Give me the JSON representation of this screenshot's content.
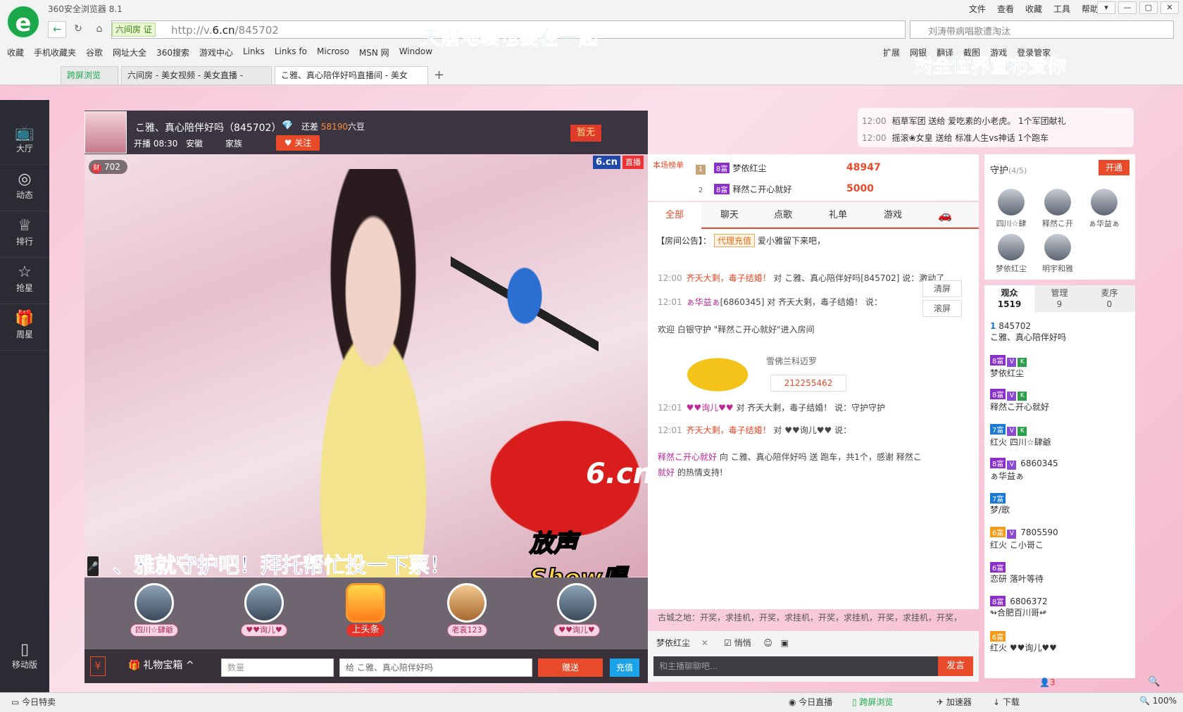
{
  "browser": {
    "title": "360安全浏览器 8.1",
    "menu": [
      "文件",
      "查看",
      "收藏",
      "工具",
      "帮助"
    ],
    "url_prefix": "http://v.",
    "url_host": "6.cn",
    "url_path": "/845702",
    "site_badge": "六间房 证",
    "search_placeholder": "刘涛带病唱歌遭淘汰",
    "overlay_text_1": "天崩地裂也要在一起",
    "overlay_text_2": "对全世界宣布爱你",
    "bookmarks": [
      "收藏",
      "手机收藏夹",
      "谷歌",
      "网址大全",
      "360搜索",
      "游戏中心",
      "Links",
      "Links fo",
      "Microso",
      "MSN 网",
      "Window"
    ],
    "extensions": [
      "扩展",
      "网银",
      "翻译",
      "截图",
      "游戏",
      "登录管家"
    ],
    "tabs": [
      {
        "label": "跨屏浏览"
      },
      {
        "label": "六间房 - 美女视频 - 美女直播 -"
      },
      {
        "label": "こ雅、真心陪伴好吗直播间 - 美女"
      }
    ]
  },
  "nav": {
    "items": [
      "大厅",
      "动态",
      "排行",
      "抢星",
      "周星"
    ],
    "mobile": "移动版"
  },
  "room": {
    "title": "こ雅、真心陪伴好吗（845702）",
    "remain_prefix": "还差",
    "remain_amount": "58190",
    "remain_suffix": "六豆",
    "start": "开播 08:30",
    "location": "安徽",
    "family": "家族",
    "follow": "关注",
    "flag": "暂无",
    "wealth": "702",
    "live_logo": "6.cn",
    "live_tag": "直播",
    "scroll_text": "、雅就守护吧！拜托帮忙投一下票！",
    "show_tag": "放声Show唱",
    "car_logo": "6.cn"
  },
  "stage_guards": [
    {
      "name": "四川☆肆爺"
    },
    {
      "name": "♥♥询儿♥"
    },
    {
      "name": "上头条"
    },
    {
      "name": "老袁123"
    },
    {
      "name": "♥♥询儿♥"
    }
  ],
  "gift": {
    "box": "礼物宝箱",
    "qty_placeholder": "数量",
    "to": "给 こ雅、真心陪伴好吗",
    "send": "赠送",
    "recharge": "充值"
  },
  "notices": [
    {
      "time": "12:00",
      "text": "稻草军团 送给 爱吃素的小老虎。 1个军团献礼"
    },
    {
      "time": "12:00",
      "text": "摇滚❀女皇 送给 标准人生vs神话 1个跑车"
    }
  ],
  "ranking": {
    "label": "本场榜单",
    "rows": [
      {
        "rank": "1",
        "badge": "8富",
        "name": "梦依红尘",
        "score": "48947"
      },
      {
        "rank": "2",
        "badge": "8富",
        "name": "释然こ开心就好",
        "score": "5000"
      }
    ]
  },
  "chat_tabs": [
    "全部",
    "聊天",
    "点歌",
    "礼单",
    "游戏"
  ],
  "chat": {
    "announce_label": "【房间公告】：",
    "announce_tag": "代理充值",
    "announce_text": "爱小雅留下来吧，",
    "lines": [
      {
        "time": "12:00",
        "user": "齐天大剩，毒子结婚！",
        "text": " 对 こ雅、真心陪伴好吗[845702] 说：激动了"
      },
      {
        "time": "12:01",
        "user": "ぁ华益ぁ",
        "text": "[6860345] 对 齐天大剩，毒子结婚！ 说："
      },
      {
        "time": "",
        "user": "欢迎",
        "text": " 白银守护 \"释然こ开心就好\"进入房间"
      },
      {
        "time": "12:01",
        "user": "♥♥询儿♥♥",
        "text": " 对 齐天大剩，毒子结婚！ 说：守护守护"
      },
      {
        "time": "12:01",
        "user": "齐天大剩，毒子结婚！",
        "text": " 对 ♥♥询儿♥♥ 说："
      },
      {
        "time": "",
        "user": "释然こ开心就好",
        "text": " 向 こ雅、真心陪伴好吗 送 跑车，共1个，感谢 释然こ"
      },
      {
        "time": "",
        "user": "就好",
        "text": " 的热情支持!"
      }
    ],
    "clear": "清屏",
    "scroll": "滚屏",
    "car_name": "雪佛兰科迈罗",
    "car_id": "212255462",
    "broadcast": "古城之地：开奖，求挂机，开奖，求挂机，开奖，求挂机，开奖，求挂机，开奖，"
  },
  "input": {
    "target": "梦依红尘",
    "whisper": "悄悄",
    "placeholder": "和主播聊聊吧...",
    "send": "发言"
  },
  "guard_panel": {
    "title": "守护",
    "count": "(4/5)",
    "open": "开通",
    "members": [
      "四川☆肆",
      "释然こ开",
      "ぁ华益ぁ",
      "梦依红尘",
      "明宇和雅"
    ]
  },
  "audience_tabs": [
    {
      "label": "观众",
      "count": "1519"
    },
    {
      "label": "管理",
      "count": "9"
    },
    {
      "label": "麦序",
      "count": "0"
    }
  ],
  "audience": [
    {
      "badge": "1",
      "id": "845702",
      "name": "こ雅、真心陪伴好吗"
    },
    {
      "badge": "8富",
      "id": "",
      "name": "梦依红尘"
    },
    {
      "badge": "8富",
      "id": "",
      "name": "释然こ开心就好"
    },
    {
      "badge": "7富",
      "id": "",
      "name": "红火 四川☆肆爺"
    },
    {
      "badge": "8富",
      "id": "6860345",
      "name": "ぁ华益ぁ"
    },
    {
      "badge": "7富",
      "id": "",
      "name": "梦/歌"
    },
    {
      "badge": "6富",
      "id": "7805590",
      "name": "红火 こ小哥こ"
    },
    {
      "badge": "6富",
      "id": "",
      "name": "恋研 落叶等待"
    },
    {
      "badge": "8富",
      "id": "6806372",
      "name": "↬合肥百川哥↫"
    },
    {
      "badge": "6富",
      "id": "",
      "name": "红火 ♥♥询儿♥♥"
    }
  ],
  "audience_footer": {
    "online": "3"
  },
  "status": {
    "left": "今日特卖",
    "items": [
      "今日直播",
      "跨屏浏览",
      "加速器",
      "下载"
    ],
    "zoom": "100%"
  },
  "colors": {
    "accent": "#e84a2a",
    "brand": "#1aa84a",
    "nav_bg": "#2b2b33"
  }
}
